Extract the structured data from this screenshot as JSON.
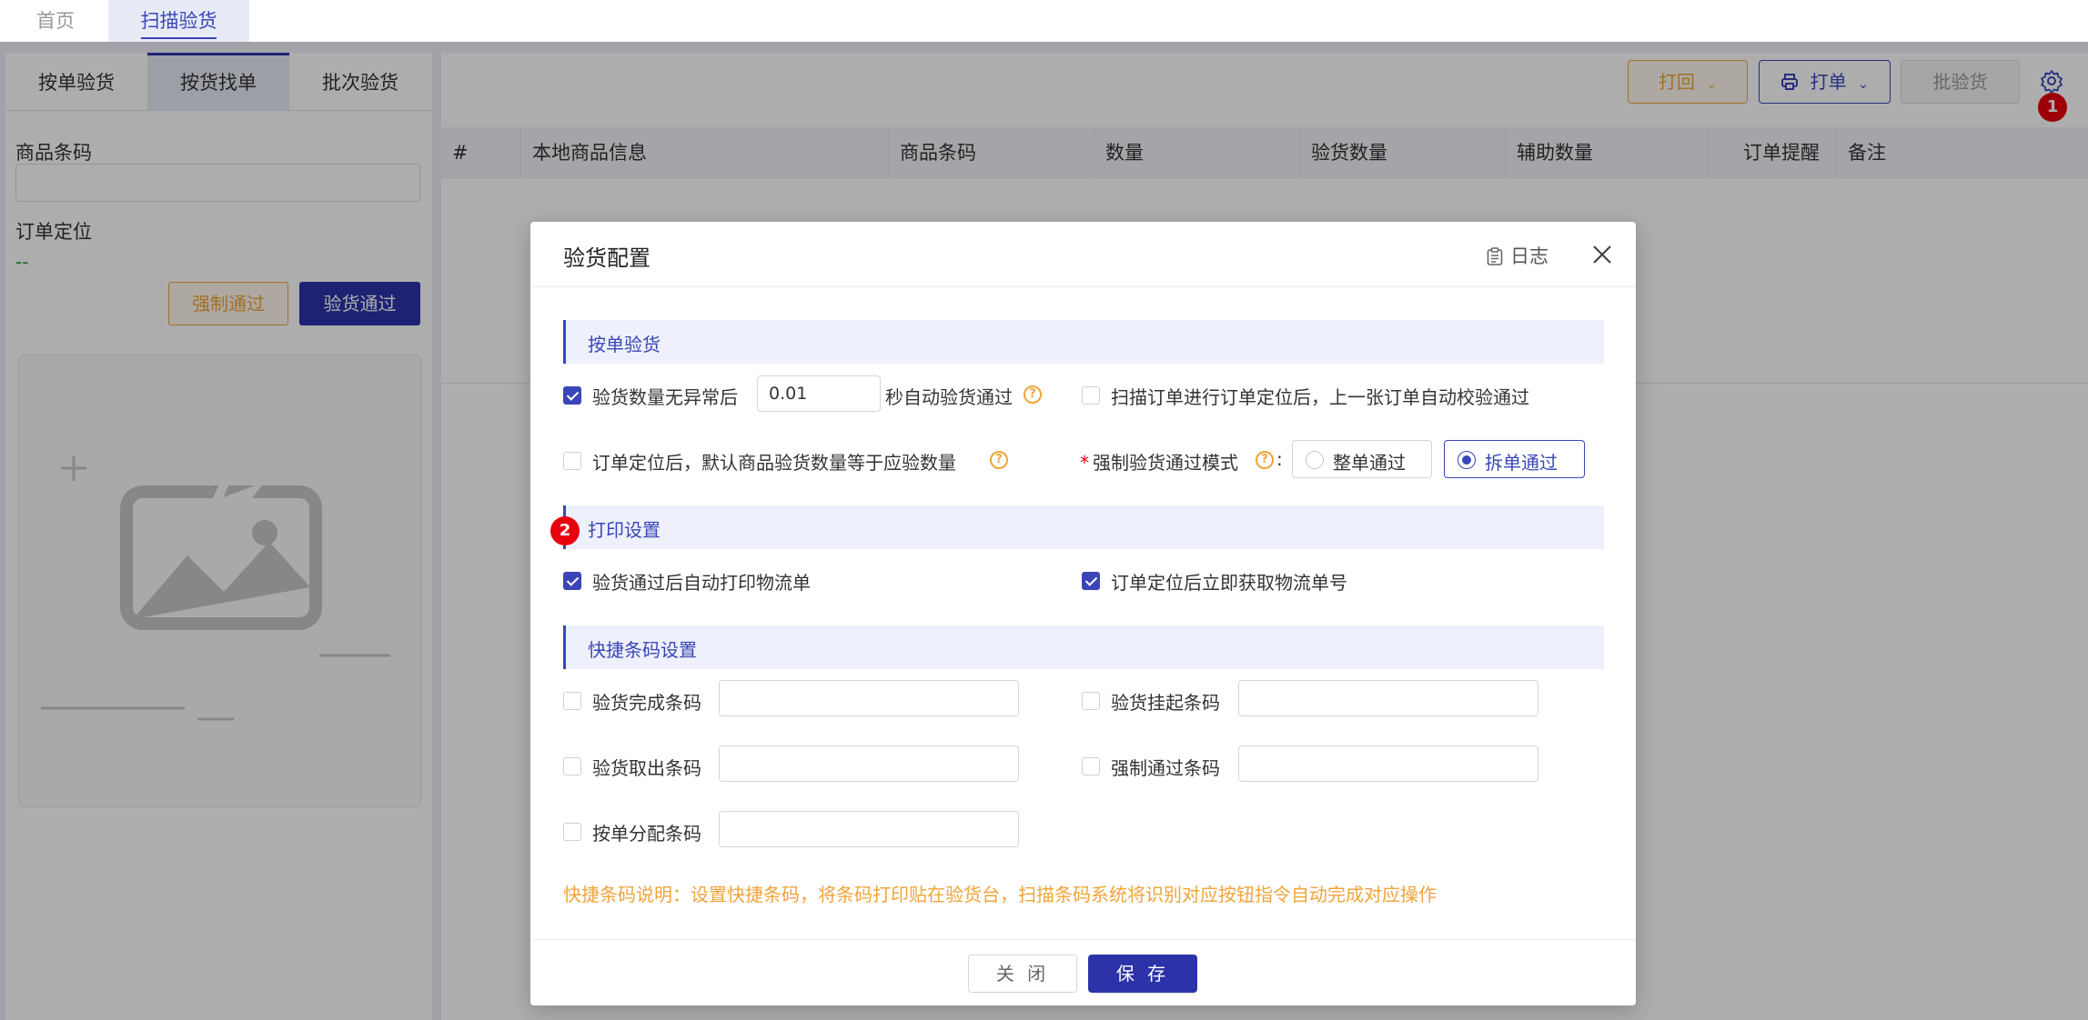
{
  "top_tabs": {
    "home": "首页",
    "active": "扫描验货"
  },
  "left": {
    "tabs": [
      "按单验货",
      "按货找单",
      "批次验货"
    ],
    "barcode_label": "商品条码",
    "order_label": "订单定位",
    "order_value": "--",
    "force_button": "强制通过",
    "pass_button": "验货通过"
  },
  "toolbar": {
    "return_label": "打回",
    "print_label": "打单",
    "batch_label": "批验货"
  },
  "badges": {
    "one": "1",
    "two": "2"
  },
  "table": {
    "columns": [
      "#",
      "本地商品信息",
      "商品条码",
      "数量",
      "验货数量",
      "辅助数量",
      "订单提醒",
      "备注"
    ]
  },
  "modal": {
    "title": "验货配置",
    "log_label": "日志",
    "sections": {
      "by_order": "按单验货",
      "print": "打印设置",
      "shortcut": "快捷条码设置"
    },
    "by_order": {
      "auto_pass_prefix": "验货数量无异常后",
      "auto_pass_value": "0.01",
      "auto_pass_suffix": "秒自动验货通过",
      "auto_verify": "扫描订单进行订单定位后，上一张订单自动校验通过",
      "default_qty": "订单定位后，默认商品验货数量等于应验数量",
      "force_mode_label": "强制验货通过模式",
      "force_mode_options": [
        "整单通过",
        "拆单通过"
      ],
      "force_mode_selected": "拆单通过"
    },
    "print": {
      "auto_print": "验货通过后自动打印物流单",
      "auto_fetch": "订单定位后立即获取物流单号"
    },
    "shortcut": {
      "complete": "验货完成条码",
      "suspend": "验货挂起条码",
      "takeout": "验货取出条码",
      "force": "强制通过条码",
      "assign": "按单分配条码"
    },
    "note": "快捷条码说明：设置快捷条码，将条码打印贴在验货台，扫描条码系统将识别对应按钮指令自动完成对应操作",
    "close_button": "关 闭",
    "save_button": "保 存"
  },
  "colors": {
    "primary": "#2c33a8",
    "accent": "#3a46b8",
    "warning": "#f0a43a",
    "badge": "#e8000e"
  }
}
